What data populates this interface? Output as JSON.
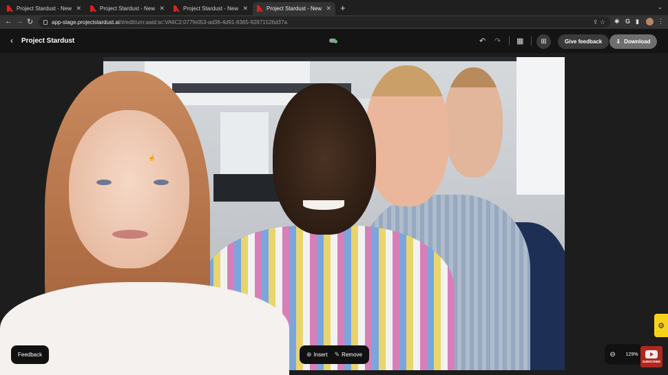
{
  "browser": {
    "tabs": [
      {
        "title": "Project Stardust - New Project"
      },
      {
        "title": "Project Stardust - New Project"
      },
      {
        "title": "Project Stardust - New Project"
      },
      {
        "title": "Project Stardust - New Project"
      }
    ],
    "url_host": "app-stage.projectstardust.ai",
    "url_path": "/#/edit/urn:aaid:sc:VA6C2:077fe053-ad36-4d91-8365-92871526d37a"
  },
  "app": {
    "title": "Project Stardust",
    "give_feedback_label": "Give feedback",
    "download_label": "Download"
  },
  "overlay": {
    "feedback_label": "Feedback",
    "insert_label": "Insert",
    "remove_label": "Remove",
    "zoom_level": "129%",
    "subscribe_label": "SUBSCRIBE"
  },
  "colors": {
    "accent_yellow": "#f7d21a",
    "adobe_red": "#e0201b",
    "subscribe_red": "#b3261e"
  }
}
